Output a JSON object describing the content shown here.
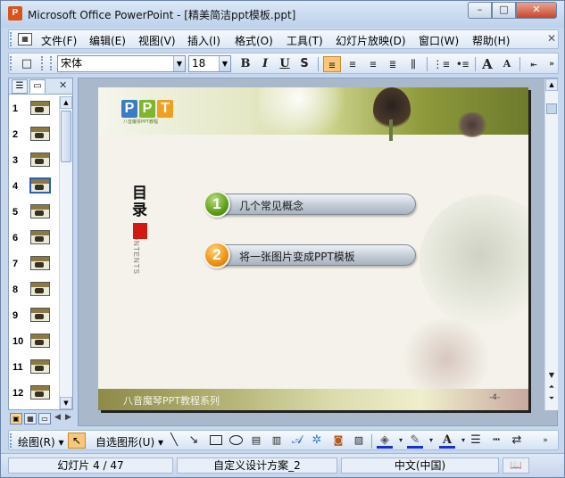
{
  "window": {
    "title": "Microsoft Office PowerPoint - [精美简洁ppt模板.ppt]",
    "controls": {
      "minimize": "–",
      "maximize": "□",
      "close": "✕"
    }
  },
  "menu": {
    "items": [
      "文件(F)",
      "编辑(E)",
      "视图(V)",
      "插入(I)",
      "格式(O)",
      "工具(T)",
      "幻灯片放映(D)",
      "窗口(W)",
      "帮助(H)"
    ],
    "close_glyph": "✕"
  },
  "format_toolbar": {
    "font_name": "宋体",
    "font_size": "18",
    "bold": "B",
    "italic": "I",
    "underline": "U",
    "shadow": "S",
    "grow_font": "A",
    "shrink_font": "A"
  },
  "pane": {
    "close_glyph": "✕",
    "slide_numbers": [
      "1",
      "2",
      "3",
      "4",
      "5",
      "6",
      "7",
      "8",
      "9",
      "10",
      "11",
      "12"
    ],
    "selected_slide": 4
  },
  "slide": {
    "logo_letters": [
      "P",
      "P",
      "T"
    ],
    "logo_subtitle": "八音魔琴PPT教程",
    "toc_title": "目录",
    "toc_subtitle": "CONTENTS",
    "items": [
      {
        "number": "1",
        "label": "几个常见概念"
      },
      {
        "number": "2",
        "label": "将一张图片变成PPT模板"
      }
    ],
    "footer": "八音魔琴PPT教程系列",
    "page_number": "-4-"
  },
  "draw_toolbar": {
    "draw_label": "绘图(R)",
    "autoshapes_label": "自选图形(U)"
  },
  "status": {
    "slide": "幻灯片 4 / 47",
    "design": "自定义设计方案_2",
    "language": "中文(中国)"
  },
  "colors": {
    "accent_selected": "#f9c778",
    "item1_badge": "#5f9e1c",
    "item2_badge": "#ee9212",
    "toc_block": "#d01a12"
  }
}
